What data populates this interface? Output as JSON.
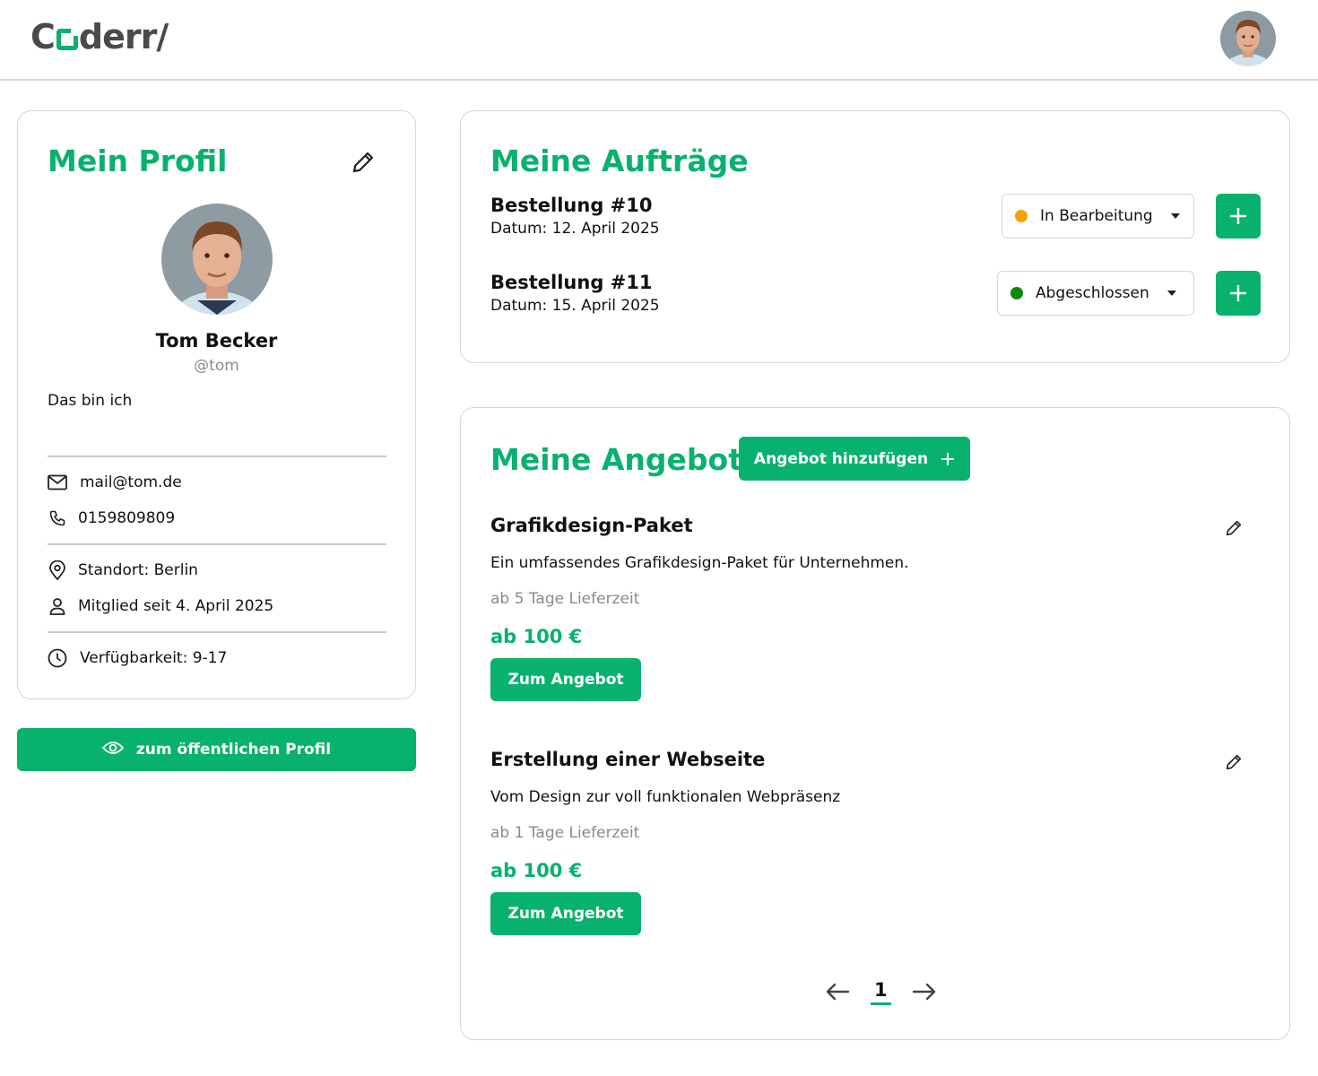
{
  "header": {
    "logo_text_1": "C",
    "logo_text_2": "derr/",
    "avatar_alt": "user-avatar"
  },
  "profile": {
    "title": "Mein Profil",
    "name": "Tom Becker",
    "handle": "@tom",
    "bio": "Das bin ich",
    "email": "mail@tom.de",
    "phone": "0159809809",
    "location": "Standort: Berlin",
    "member_since": "Mitglied seit 4. April 2025",
    "availability": "Verfügbarkeit: 9-17",
    "public_profile_button": "zum öffentlichen Profil"
  },
  "orders": {
    "title": "Meine Aufträge",
    "items": [
      {
        "name": "Bestellung #10",
        "date": "Datum: 12. April 2025",
        "status": "In Bearbeitung",
        "status_color": "#f5a300"
      },
      {
        "name": "Bestellung #11",
        "date": "Datum: 15. April 2025",
        "status": "Abgeschlossen",
        "status_color": "#0b8a12"
      }
    ]
  },
  "offers": {
    "title": "Meine Angebote",
    "add_button": "Angebot hinzufügen",
    "items": [
      {
        "name": "Grafikdesign-Paket",
        "description": "Ein umfassendes Grafikdesign-Paket für Unternehmen.",
        "delivery": "ab 5 Tage Lieferzeit",
        "price": "ab 100 €",
        "button": "Zum Angebot"
      },
      {
        "name": "Erstellung einer Webseite",
        "description": "Vom Design zur voll funktionalen Webpräsenz",
        "delivery": "ab 1 Tage Lieferzeit",
        "price": "ab 100 €",
        "button": "Zum Angebot"
      }
    ],
    "pagination": {
      "current_page": "1"
    }
  },
  "colors": {
    "accent": "#09b16e",
    "muted_text": "#8a8a8a",
    "border": "#d6d6d6"
  }
}
